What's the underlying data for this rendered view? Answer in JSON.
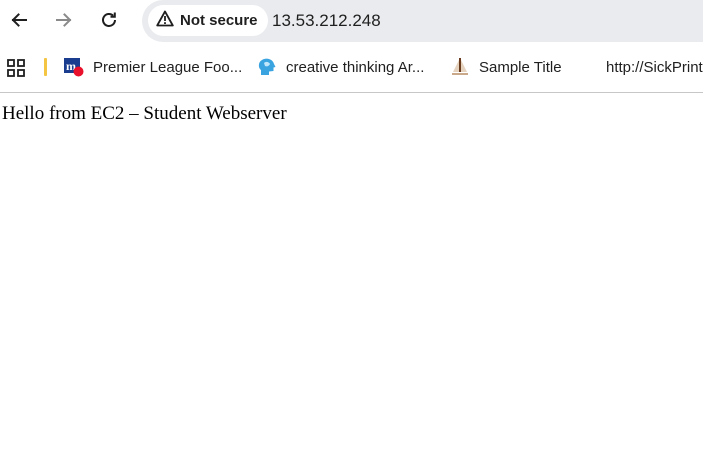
{
  "toolbar": {
    "back_icon": "arrow-left-icon",
    "forward_icon": "arrow-right-icon",
    "reload_icon": "reload-icon"
  },
  "omnibox": {
    "security_label": "Not secure",
    "security_icon": "warning-triangle-icon",
    "url": "13.53.212.248"
  },
  "bookmarks": {
    "apps_icon": "apps-grid-icon",
    "items": [
      {
        "label": "Premier League Foo...",
        "icon": "premier-league-favicon"
      },
      {
        "label": "creative thinking Ar...",
        "icon": "creative-thinking-favicon"
      },
      {
        "label": "Sample Title",
        "icon": "sample-title-favicon"
      },
      {
        "label": "http://SickPrint",
        "icon": ""
      }
    ]
  },
  "page": {
    "body_text": "Hello from EC2 – Student Webserver"
  },
  "colors": {
    "omnibox_bg": "#e9ebee",
    "divider_accent": "#f4c542",
    "separator": "#c7c7c7"
  }
}
